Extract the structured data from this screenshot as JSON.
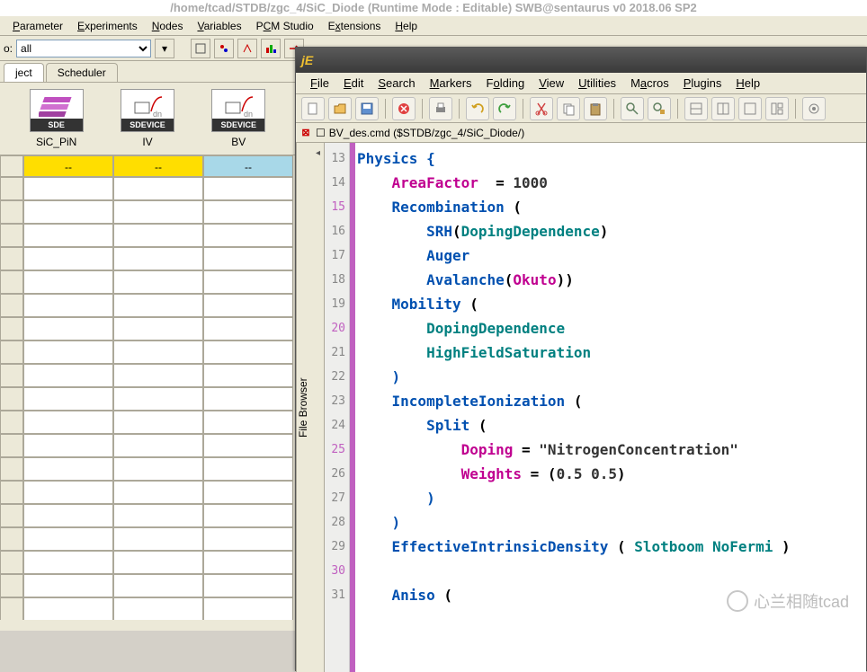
{
  "title": "/home/tcad/STDB/zgc_4/SiC_Diode (Runtime Mode : Editable)   SWB@sentaurus v0 2018.06 SP2",
  "main_menu": [
    "Parameter",
    "Experiments",
    "Nodes",
    "Variables",
    "PCM Studio",
    "Extensions",
    "Help"
  ],
  "main_menu_u": [
    "P",
    "E",
    "N",
    "V",
    "C",
    "x",
    "H"
  ],
  "filter_label": "o:",
  "filter_select": "all",
  "tabs": {
    "project": "ject",
    "scheduler": "Scheduler"
  },
  "tools": [
    {
      "name": "SDE",
      "label": "SiC_PiN",
      "color": "#c050c0"
    },
    {
      "name": "SDEVICE",
      "label": "IV",
      "color": "#d0d0d0"
    },
    {
      "name": "SDEVICE",
      "label": "BV",
      "color": "#d0d0d0"
    }
  ],
  "grid": {
    "cell_dash": "--"
  },
  "editor": {
    "brand": "jE",
    "menu": [
      "File",
      "Edit",
      "Search",
      "Markers",
      "Folding",
      "View",
      "Utilities",
      "Macros",
      "Plugins",
      "Help"
    ],
    "menu_u": [
      "F",
      "E",
      "S",
      "M",
      "o",
      "V",
      "U",
      "a",
      "P",
      "H"
    ],
    "filename": "BV_des.cmd ($STDB/zgc_4/SiC_Diode/)",
    "file_browser": "File Browser",
    "first_line": 13,
    "code": [
      [
        {
          "t": "Physics {",
          "c": "kw"
        }
      ],
      [
        {
          "t": "    ",
          "c": ""
        },
        {
          "t": "AreaFactor",
          "c": "fn"
        },
        {
          "t": "  = ",
          "c": ""
        },
        {
          "t": "1000",
          "c": "num"
        }
      ],
      [
        {
          "t": "    ",
          "c": ""
        },
        {
          "t": "Recombination",
          "c": "kw"
        },
        {
          "t": " (",
          "c": ""
        }
      ],
      [
        {
          "t": "        ",
          "c": ""
        },
        {
          "t": "SRH",
          "c": "kw"
        },
        {
          "t": "(",
          "c": ""
        },
        {
          "t": "DopingDependence",
          "c": "id"
        },
        {
          "t": ")",
          "c": ""
        }
      ],
      [
        {
          "t": "        ",
          "c": ""
        },
        {
          "t": "Auger",
          "c": "kw"
        }
      ],
      [
        {
          "t": "        ",
          "c": ""
        },
        {
          "t": "Avalanche",
          "c": "kw"
        },
        {
          "t": "(",
          "c": ""
        },
        {
          "t": "Okuto",
          "c": "fn"
        },
        {
          "t": "))",
          "c": ""
        }
      ],
      [
        {
          "t": "    ",
          "c": ""
        },
        {
          "t": "Mobility",
          "c": "kw"
        },
        {
          "t": " (",
          "c": ""
        }
      ],
      [
        {
          "t": "        ",
          "c": ""
        },
        {
          "t": "DopingDependence",
          "c": "id"
        }
      ],
      [
        {
          "t": "        ",
          "c": ""
        },
        {
          "t": "HighFieldSaturation",
          "c": "id"
        }
      ],
      [
        {
          "t": "    )",
          "c": "kw"
        }
      ],
      [
        {
          "t": "    ",
          "c": ""
        },
        {
          "t": "IncompleteIonization",
          "c": "kw"
        },
        {
          "t": " (",
          "c": ""
        }
      ],
      [
        {
          "t": "        ",
          "c": ""
        },
        {
          "t": "Split",
          "c": "kw"
        },
        {
          "t": " (",
          "c": ""
        }
      ],
      [
        {
          "t": "            ",
          "c": ""
        },
        {
          "t": "Doping",
          "c": "fn"
        },
        {
          "t": " = ",
          "c": ""
        },
        {
          "t": "\"NitrogenConcentration\"",
          "c": "str"
        }
      ],
      [
        {
          "t": "            ",
          "c": ""
        },
        {
          "t": "Weights",
          "c": "fn"
        },
        {
          "t": " = (",
          "c": ""
        },
        {
          "t": "0.5 0.5",
          "c": "num"
        },
        {
          "t": ")",
          "c": ""
        }
      ],
      [
        {
          "t": "        )",
          "c": "kw"
        }
      ],
      [
        {
          "t": "    )",
          "c": "kw"
        }
      ],
      [
        {
          "t": "    ",
          "c": ""
        },
        {
          "t": "EffectiveIntrinsicDensity",
          "c": "kw"
        },
        {
          "t": " ( ",
          "c": ""
        },
        {
          "t": "Slotboom",
          "c": "id"
        },
        {
          "t": " ",
          "c": ""
        },
        {
          "t": "NoFermi",
          "c": "id"
        },
        {
          "t": " )",
          "c": ""
        }
      ],
      [
        {
          "t": "",
          "c": ""
        }
      ],
      [
        {
          "t": "    ",
          "c": ""
        },
        {
          "t": "Aniso",
          "c": "kw"
        },
        {
          "t": " (",
          "c": ""
        }
      ]
    ],
    "gutter_highlight_mod5": true
  },
  "watermark": "心兰相随tcad"
}
